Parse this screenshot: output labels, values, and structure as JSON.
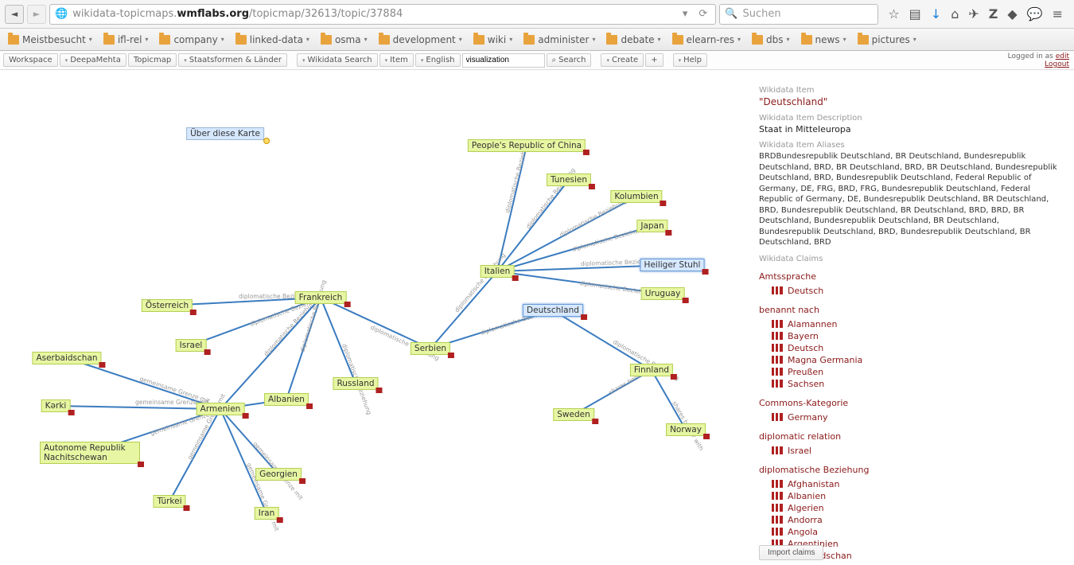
{
  "browser": {
    "url_prefix": "wikidata-topicmaps.",
    "url_host": "wmflabs.org",
    "url_path": "/topicmap/32613/topic/37884",
    "search_placeholder": "Suchen"
  },
  "bookmarks": [
    "Meistbesucht",
    "ifl-rel",
    "company",
    "linked-data",
    "osma",
    "development",
    "wiki",
    "administer",
    "debate",
    "elearn-res",
    "dbs",
    "news",
    "pictures"
  ],
  "toolbar": {
    "workspace": "Workspace",
    "deepa": "DeepaMehta",
    "topicmap": "Topicmap",
    "topicmap_name": "Staatsformen & Länder",
    "wikidata_search": "Wikidata Search",
    "item": "Item",
    "language": "English",
    "search_value": "visualization",
    "search_btn": "Search",
    "create": "Create",
    "plus": "+",
    "help": "Help",
    "logged_in": "Logged in as",
    "logged_user": "edit",
    "logout": "Logout"
  },
  "graph": {
    "about": "Über diese Karte",
    "edge_diplom": "diplomatische Beziehung",
    "edge_grenze": "gemeinsame Grenze mit",
    "edge_shares": "shares border with",
    "nodes": {
      "deutschland": "Deutschland",
      "italien": "Italien",
      "frankreich": "Frankreich",
      "serbien": "Serbien",
      "oesterreich": "Österreich",
      "israel": "Israel",
      "russland": "Russland",
      "albanien": "Albanien",
      "armenien": "Armenien",
      "georgien": "Georgien",
      "tuerkei": "Türkei",
      "iran": "Iran",
      "kerki": "Kərki",
      "aserbaidschan": "Aserbaidschan",
      "autonome": "Autonome Republik Nachitschewan",
      "china": "People's Republic of China",
      "tunesien": "Tunesien",
      "kolumbien": "Kolumbien",
      "japan": "Japan",
      "heiliger_stuhl": "Heiliger Stuhl",
      "uruguay": "Uruguay",
      "finnland": "Finnland",
      "sweden": "Sweden",
      "norway": "Norway"
    }
  },
  "detail": {
    "h_item": "Wikidata Item",
    "title": "\"Deutschland\"",
    "h_desc": "Wikidata Item Description",
    "desc": "Staat in Mitteleuropa",
    "h_alias": "Wikidata Item Aliases",
    "aliases": "BRDBundesrepublik Deutschland, BR Deutschland, Bundesrepublik Deutschland, BRD, BR Deutschland, BRD, BR Deutschland, Bundesrepublik Deutschland, BRD, Bundesrepublik Deutschland, Federal Republic of Germany, DE, FRG, BRD, FRG, Bundesrepublik Deutschland, Federal Republic of Germany, DE, Bundesrepublik Deutschland, BR Deutschland, BRD, Bundesrepublik Deutschland, BR Deutschland, BRD, BRD, BR Deutschland, Bundesrepublik Deutschland, BR Deutschland, Bundesrepublik Deutschland, BRD, Bundesrepublik Deutschland, BR Deutschland, BRD",
    "h_claims": "Wikidata Claims",
    "claims": [
      {
        "prop": "Amtssprache",
        "vals": [
          "Deutsch"
        ]
      },
      {
        "prop": "benannt nach",
        "vals": [
          "Alamannen",
          "Bayern",
          "Deutsch",
          "Magna Germania",
          "Preußen",
          "Sachsen"
        ]
      },
      {
        "prop": "Commons-Kategorie",
        "vals": [
          "Germany"
        ]
      },
      {
        "prop": "diplomatic relation",
        "vals": [
          "Israel"
        ]
      },
      {
        "prop": "diplomatische Beziehung",
        "vals": [
          "Afghanistan",
          "Albanien",
          "Algerien",
          "Andorra",
          "Angola",
          "Argentinien",
          "Aserbaidschan"
        ]
      }
    ],
    "import": "Import claims"
  }
}
